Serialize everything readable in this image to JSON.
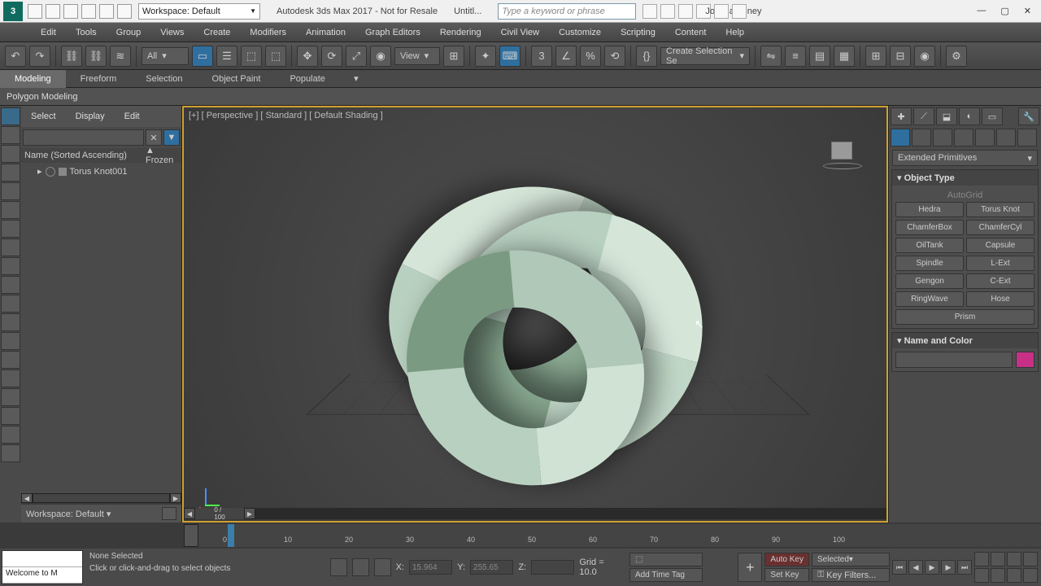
{
  "titlebar": {
    "workspace": "Workspace: Default",
    "app_title": "Autodesk 3ds Max 2017 - Not for Resale",
    "doc_title": "Untitl...",
    "search_placeholder": "Type a keyword or phrase",
    "user": "JoshuaKinney"
  },
  "menu": [
    "Edit",
    "Tools",
    "Group",
    "Views",
    "Create",
    "Modifiers",
    "Animation",
    "Graph Editors",
    "Rendering",
    "Civil View",
    "Customize",
    "Scripting",
    "Content",
    "Help"
  ],
  "maintool": {
    "filter": "All",
    "view": "View",
    "sel_set": "Create Selection Se"
  },
  "ribbon": {
    "tabs": [
      "Modeling",
      "Freeform",
      "Selection",
      "Object Paint",
      "Populate"
    ],
    "sub": "Polygon Modeling"
  },
  "scene_explorer": {
    "tabs": [
      "Select",
      "Display",
      "Edit"
    ],
    "header_name": "Name (Sorted Ascending)",
    "header_frozen": "▲ Frozen",
    "items": [
      {
        "name": "Torus Knot001"
      }
    ],
    "workspace": "Workspace: Default"
  },
  "viewport": {
    "label": "[+] [ Perspective ] [ Standard ] [ Default Shading ]",
    "frame": "0 / 100",
    "ticks": [
      "0",
      "10",
      "20",
      "30",
      "40",
      "50",
      "60",
      "70",
      "80",
      "90",
      "100"
    ]
  },
  "command_panel": {
    "category": "Extended Primitives",
    "object_type_title": "Object Type",
    "autogrid": "AutoGrid",
    "buttons": [
      "Hedra",
      "Torus Knot",
      "ChamferBox",
      "ChamferCyl",
      "OilTank",
      "Capsule",
      "Spindle",
      "L-Ext",
      "Gengon",
      "C-Ext",
      "RingWave",
      "Hose",
      "Prism"
    ],
    "name_color_title": "Name and Color",
    "obj_name": ""
  },
  "status": {
    "mini1": "",
    "mini2": "Welcome to M",
    "sel": "None Selected",
    "prompt": "Click or click-and-drag to select objects",
    "x_label": "X:",
    "x_val": "15.964",
    "y_label": "Y:",
    "y_val": "255.65",
    "z_label": "Z:",
    "z_val": "",
    "grid": "Grid = 10.0",
    "add_tag": "Add Time Tag",
    "auto_key": "Auto Key",
    "set_key": "Set Key",
    "selected": "Selected",
    "key_filters": "Key Filters..."
  }
}
